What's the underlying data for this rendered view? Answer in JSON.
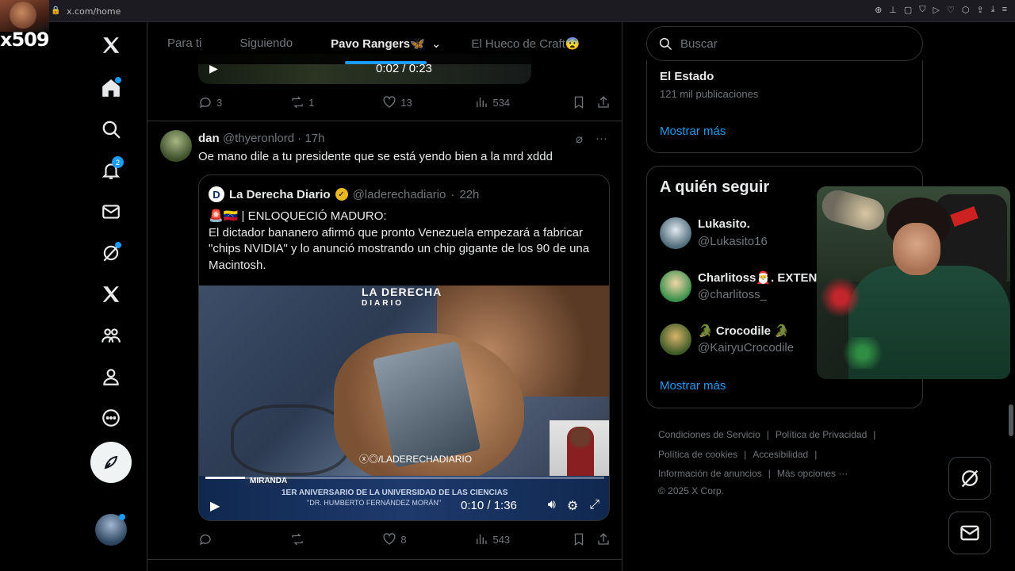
{
  "browser": {
    "url": "x.com/home",
    "extension_icons": [
      "zoom-icon",
      "pin-icon",
      "bookmark-icon",
      "shield-icon",
      "play-icon",
      "heart-icon",
      "extension-icon",
      "share-icon",
      "download-icon",
      "menu-icon"
    ]
  },
  "overlay": {
    "stream_name": "x509"
  },
  "nav": {
    "items": [
      {
        "name": "x-logo-icon"
      },
      {
        "name": "home-icon"
      },
      {
        "name": "search-icon"
      },
      {
        "name": "notifications-icon",
        "badge": "2"
      },
      {
        "name": "messages-icon"
      },
      {
        "name": "grok-icon"
      },
      {
        "name": "premium-x-icon"
      },
      {
        "name": "communities-icon"
      },
      {
        "name": "profile-icon"
      },
      {
        "name": "more-icon"
      }
    ]
  },
  "feed": {
    "tabs": [
      {
        "label": "Para ti"
      },
      {
        "label": "Siguiendo"
      },
      {
        "label": "Pavo Rangers🦋"
      },
      {
        "label": "El Hueco de Craft😨"
      }
    ],
    "prev_tweet": {
      "video_time": "0:02 / 0:23",
      "replies": "3",
      "reposts": "1",
      "likes": "13",
      "views": "534"
    },
    "tweet": {
      "author_name": "dan",
      "author_handle": "@thyeronlord",
      "time": "17h",
      "text": "Oe mano dile a tu presidente que se está yendo bien a la mrd xddd",
      "quote": {
        "logo_letter": "D",
        "author_name": "La Derecha Diario",
        "author_handle": "@laderechadiario",
        "time": "22h",
        "text_lines": [
          "🚨🇻🇪 | ENLOQUECIÓ MADURO:",
          "El dictador bananero afirmó que pronto Venezuela empezará a fabricar",
          "\"chips NVIDIA\" y lo anunció mostrando un chip gigante de los 90 de una",
          "Macintosh."
        ],
        "video": {
          "logo_line1": "LA DERECHA",
          "logo_line2": "DIARIO",
          "watermark": "ⓧ◎/LADERECHADIARIO",
          "lower_tag": "MIRANDA",
          "lower_title": "1ER ANIVERSARIO DE LA UNIVERSIDAD DE LAS CIENCIAS",
          "lower_subtitle": "\"DR. HUMBERTO FERNÁNDEZ MORÁN\"",
          "time": "0:10 / 1:36",
          "progress": 0.1
        }
      },
      "replies": "",
      "reposts": "",
      "likes": "8",
      "views": "543"
    }
  },
  "sidebar": {
    "search_placeholder": "Buscar",
    "trend": {
      "name": "El Estado",
      "count": "121 mil publicaciones"
    },
    "show_more": "Mostrar más",
    "who_to_follow_title": "A quién seguir",
    "who_to_follow": [
      {
        "name": "Lukasito.",
        "handle": "@Lukasito16"
      },
      {
        "name": "Charlitoss🎅. EXTENS",
        "handle": "@charlitoss_"
      },
      {
        "name": "🐊 Crocodile 🐊",
        "handle": "@KairyuCrocodile"
      }
    ],
    "footer_links": [
      "Condiciones de Servicio",
      "Política de Privacidad",
      "Política de cookies",
      "Accesibilidad",
      "Información de anuncios",
      "Más opciones ···"
    ],
    "copyright": "© 2025 X Corp."
  },
  "colors": {
    "accent": "#1d9bf0",
    "background": "#000000",
    "border": "#2f3336",
    "muted_text": "#71767b"
  }
}
